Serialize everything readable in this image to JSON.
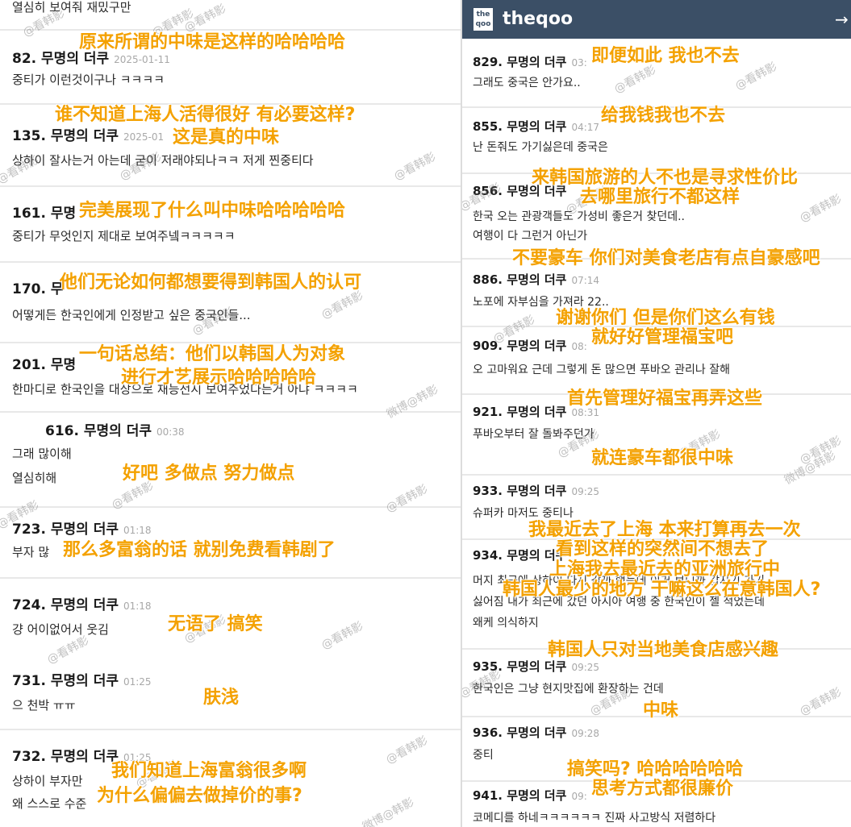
{
  "left": {
    "top_fragment": "열심히 보여줘 재밌구만",
    "comments": [
      {
        "header": "82. 무명의 더쿠",
        "time": "2025-01-11",
        "text": "중티가 이런것이구나 ㅋㅋㅋㅋ"
      },
      {
        "header": "135. 무명의 더쿠",
        "time": "2025-01",
        "text": "상하이 잘사는거 아는데 굳이 저래야되나ㅋㅋ 저게 찐중티다"
      },
      {
        "header": "161. 무명",
        "time": "",
        "text": "중티가 무엇인지 제대로 보여주넼ㅋㅋㅋㅋㅋ"
      },
      {
        "header": "170. 무",
        "time": "",
        "text": "어떻게든 한국인에게 인정받고 싶은 중국인들..."
      },
      {
        "header": "201. 무명",
        "time": "",
        "text": "한마디로 한국인을 대상으로 재능전시 보여주었다는거 아냐 ㅋㅋㅋㅋ"
      },
      {
        "header": "616. 무명의 더쿠",
        "time": "00:38",
        "text": "그래 많이해",
        "text2": "열심히해"
      },
      {
        "header": "723. 무명의 더쿠",
        "time": "01:18",
        "text": "부자 많"
      },
      {
        "header": "724. 무명의 더쿠",
        "time": "01:18",
        "text": "걍 어이없어서 웃김"
      },
      {
        "header": "731. 무명의 더쿠",
        "time": "01:25",
        "text": "으 천박 ㅠㅠ"
      },
      {
        "header": "732. 무명의 더쿠",
        "time": "01:25",
        "text": "상하이 부자만",
        "text2": "왜 스스로 수준"
      }
    ],
    "overlays": [
      "原来所谓的中味是这样的哈哈哈哈",
      "谁不知道上海人活得很好 有必要这样?",
      "这是真的中味",
      "完美展现了什么叫中味哈哈哈哈哈",
      "他们无论如何都想要得到韩国人的认可",
      "一句话总结：他们以韩国人为对象",
      "进行才艺展示哈哈哈哈哈",
      "好吧 多做点 努力做点",
      "那么多富翁的话 就别免费看韩剧了",
      "无语了 搞笑",
      "肤浅",
      "我们知道上海富翁很多啊",
      "为什么偏偏去做掉价的事?"
    ]
  },
  "right": {
    "app_title": "theqoo",
    "logo_text": "the qoo",
    "login_icon": "→",
    "comments": [
      {
        "header": "829. 무명의 더쿠",
        "time": "03:",
        "text": "그래도 중국은 안가요.."
      },
      {
        "header": "855. 무명의 더쿠",
        "time": "04:17",
        "text": "난 돈줘도 가기싫은데 중국은"
      },
      {
        "header": "856. 무명의 더쿠",
        "time": "",
        "text": "한국 오는 관광객들도 가성비 좋은거 찾던데..",
        "text2": "여행이 다 그런거 아닌가"
      },
      {
        "header": "886. 무명의 더쿠",
        "time": "07:14",
        "text": "노포에 자부심을 가져라 22.."
      },
      {
        "header": "909. 무명의 더쿠",
        "time": "08:",
        "text": "오 고마워요 근데 그렇게 돈 많으면 푸바오 관리나 잘해"
      },
      {
        "header": "921. 무명의 더쿠",
        "time": "08:31",
        "text": "푸바오부터 잘 돌봐주던가"
      },
      {
        "header": "933. 무명의 더쿠",
        "time": "09:25",
        "text": "슈퍼카 마저도 중티나"
      },
      {
        "header": "934. 무명의 더쿠",
        "time": "",
        "text": "머지 최근에 상하이 다시 갈까 했는데 이거 보니까 갑자기 가기",
        "text2": "싫어짐 내가 최근에 갔던 아시아 여행 중 한국인이 젤 적었는데",
        "text3": "왜케 의식하지"
      },
      {
        "header": "935. 무명의 더쿠",
        "time": "09:25",
        "text": "한국인은 그냥 현지맛집에 환장하는 건데"
      },
      {
        "header": "936. 무명의 더쿠",
        "time": "09:28",
        "text": "중티"
      },
      {
        "header": "941. 무명의 더쿠",
        "time": "09:",
        "text": "코메디를 하네ㅋㅋㅋㅋㅋㅋ 진짜 사고방식 저렴하다"
      }
    ],
    "overlays": [
      "即便如此 我也不去",
      "给我钱我也不去",
      "来韩国旅游的人不也是寻求性价比",
      "去哪里旅行不都这样",
      "不要豪车 你们对美食老店有点自豪感吧",
      "谢谢你们 但是你们这么有钱",
      "就好好管理福宝吧",
      "首先管理好福宝再弄这些",
      "就连豪车都很中味",
      "我最近去了上海 本来打算再去一次",
      "看到这样的突然间不想去了",
      "上海我去最近去的亚洲旅行中",
      "韩国人最少的地方 干嘛这么在意韩国人?",
      "韩国人只对当地美食店感兴趣",
      "中味",
      "搞笑吗? 哈哈哈哈哈哈",
      "思考方式都很廉价"
    ]
  },
  "watermarks": {
    "text": "@看韩影",
    "weibo": "微博@韩影"
  },
  "colors": {
    "overlay_text": "#f4a100",
    "header_bg": "#3b4f66"
  }
}
